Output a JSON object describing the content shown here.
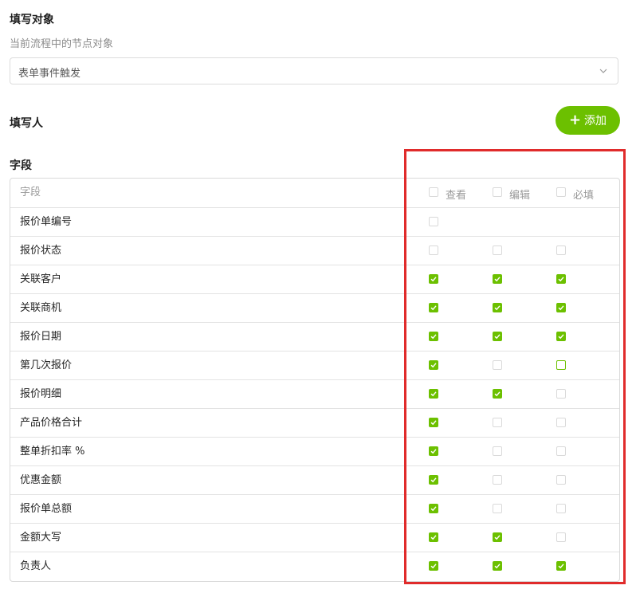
{
  "form": {
    "target_title": "填写对象",
    "target_hint": "当前流程中的节点对象",
    "target_value": "表单事件触发",
    "filler_title": "填写人",
    "add_label": "添加",
    "fields_title": "字段"
  },
  "table": {
    "header": {
      "field": "字段",
      "view": "查看",
      "edit": "编辑",
      "required": "必填"
    },
    "rows": [
      {
        "name": "报价单编号",
        "view": "off",
        "edit": "none",
        "required": "none"
      },
      {
        "name": "报价状态",
        "view": "off",
        "edit": "off",
        "required": "off"
      },
      {
        "name": "关联客户",
        "view": "on",
        "edit": "on",
        "required": "on"
      },
      {
        "name": "关联商机",
        "view": "on",
        "edit": "on",
        "required": "on"
      },
      {
        "name": "报价日期",
        "view": "on",
        "edit": "on",
        "required": "on"
      },
      {
        "name": "第几次报价",
        "view": "on",
        "edit": "off",
        "required": "outline"
      },
      {
        "name": "报价明细",
        "view": "on",
        "edit": "on",
        "required": "off"
      },
      {
        "name": "产品价格合计",
        "view": "on",
        "edit": "off",
        "required": "off"
      },
      {
        "name": "整单折扣率 %",
        "view": "on",
        "edit": "off",
        "required": "off"
      },
      {
        "name": "优惠金额",
        "view": "on",
        "edit": "off",
        "required": "off"
      },
      {
        "name": "报价单总额",
        "view": "on",
        "edit": "off",
        "required": "off"
      },
      {
        "name": "金额大写",
        "view": "on",
        "edit": "on",
        "required": "off"
      },
      {
        "name": "负责人",
        "view": "on",
        "edit": "on",
        "required": "on"
      }
    ]
  },
  "colors": {
    "accent": "#6cc000",
    "highlight": "#e02b2b",
    "border": "#d9d9d9"
  },
  "icons": {
    "dropdown": "chevron-down-icon",
    "add": "plus-icon",
    "check": "checkmark-icon"
  }
}
